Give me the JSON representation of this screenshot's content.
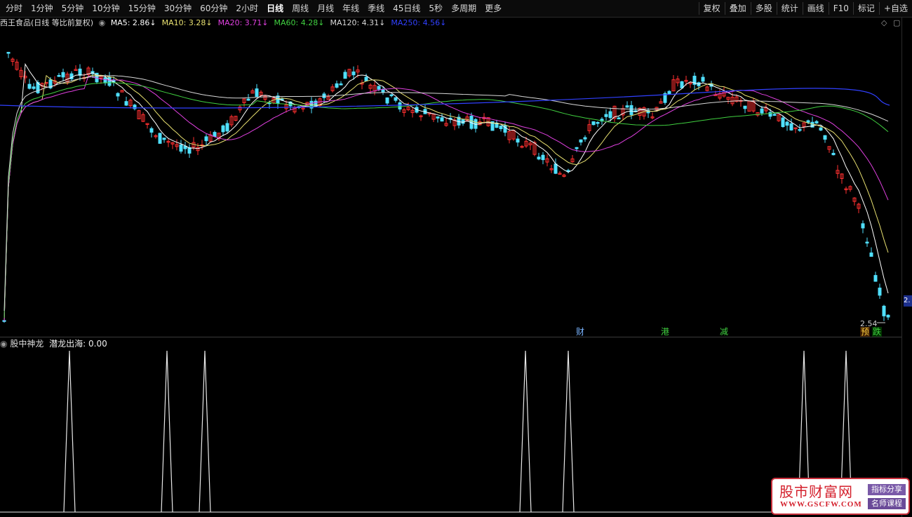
{
  "toolbar": {
    "periods": [
      "分时",
      "1分钟",
      "5分钟",
      "10分钟",
      "15分钟",
      "30分钟",
      "60分钟",
      "2小时",
      "日线",
      "周线",
      "月线",
      "年线",
      "季线",
      "45日线",
      "5秒",
      "多周期",
      "更多"
    ],
    "active_period": "日线",
    "right_items": [
      "复权",
      "叠加",
      "多股",
      "统计",
      "画线",
      "F10",
      "标记",
      "+自选"
    ]
  },
  "main_panel": {
    "stock_label": "西王食品(日线 等比前复权)",
    "ma_indicators": [
      {
        "label": "MA5: 2.86↓",
        "color": "#ffffff"
      },
      {
        "label": "MA10: 3.28↓",
        "color": "#e8e070"
      },
      {
        "label": "MA20: 3.71↓",
        "color": "#e040e0"
      },
      {
        "label": "MA60: 4.28↓",
        "color": "#40d040"
      },
      {
        "label": "MA120: 4.31↓",
        "color": "#d8d8d8"
      },
      {
        "label": "MA250: 4.56↓",
        "color": "#3040ff"
      }
    ],
    "last_price": "2.54",
    "price_tag": "2.",
    "event_markers": [
      {
        "label": "财",
        "color": "#7ab4ff",
        "bg": "none"
      },
      {
        "label": "港",
        "color": "#40d040",
        "bg": "none"
      },
      {
        "label": "减",
        "color": "#40d040",
        "bg": "none"
      },
      {
        "label": "预",
        "color": "#ffd040",
        "bg": "#3a1a00"
      },
      {
        "label": "跌",
        "color": "#40d040",
        "bg": "#003300"
      }
    ]
  },
  "sub_panel": {
    "indicator_name": "股中神龙",
    "value_label": "潜龙出海: 0.00",
    "signal_count": 7
  },
  "watermark": {
    "title": "股市财富网",
    "url": "WWW.GSCFW.COM",
    "tag1": "指标分享",
    "tag2": "名师课程"
  },
  "colors": {
    "up": "#ff3030",
    "down": "#50e0ff",
    "background": "#000000"
  }
}
